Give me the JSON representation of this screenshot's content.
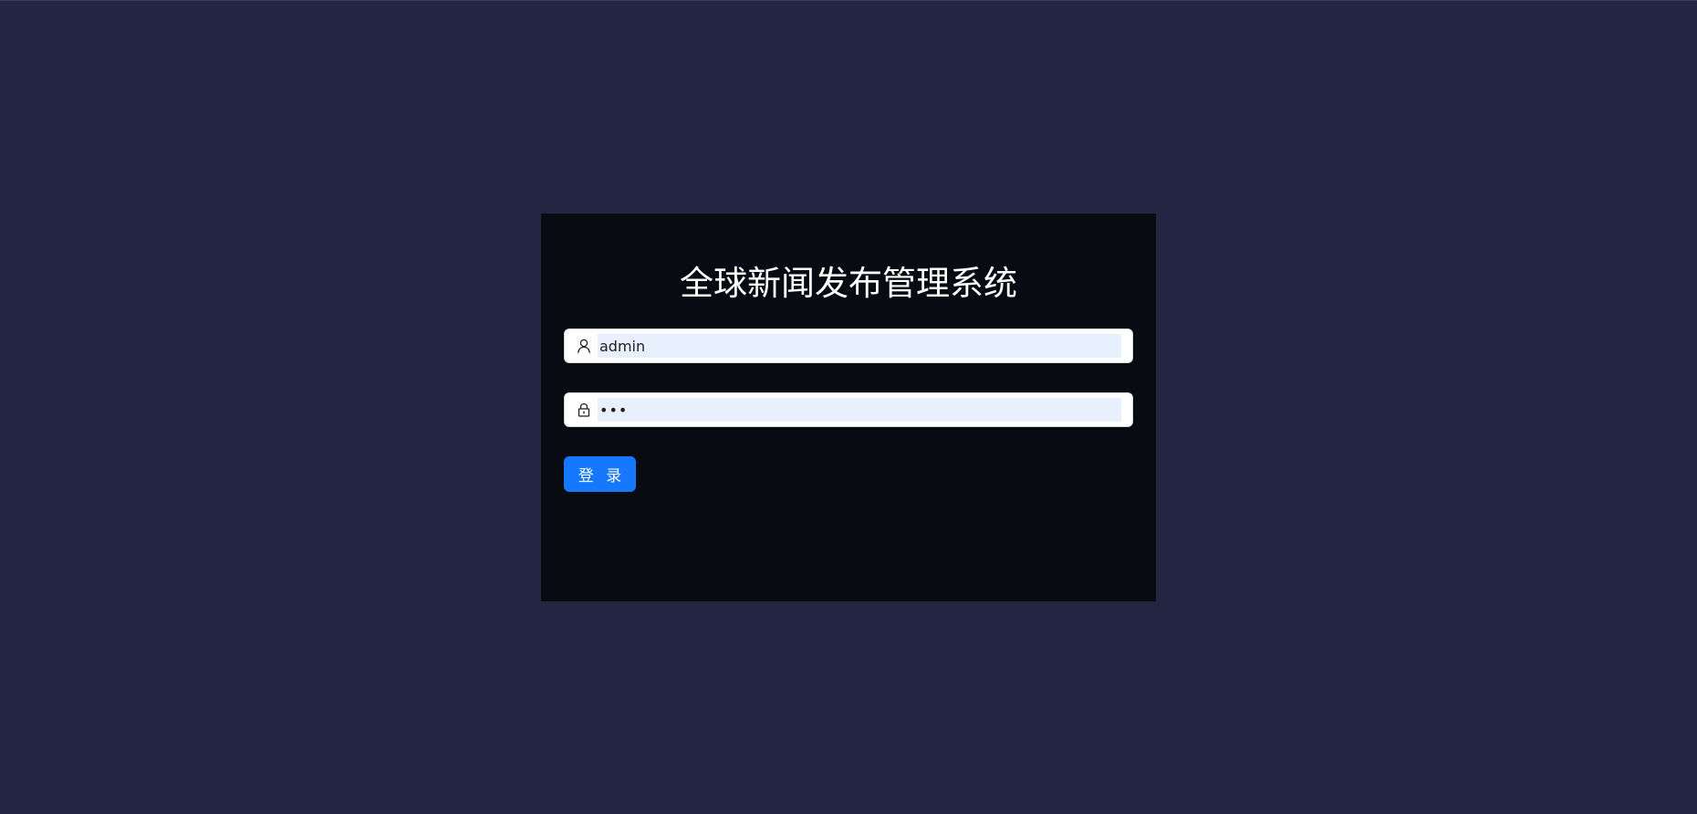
{
  "login": {
    "title": "全球新闻发布管理系统",
    "username": {
      "value": "admin",
      "icon": "user-icon"
    },
    "password": {
      "value": "•••",
      "icon": "lock-icon"
    },
    "submit_label": "登 录"
  },
  "colors": {
    "background": "#232642",
    "card": "#090b13",
    "primary": "#1677ff",
    "autofill": "#e8f0fe"
  }
}
